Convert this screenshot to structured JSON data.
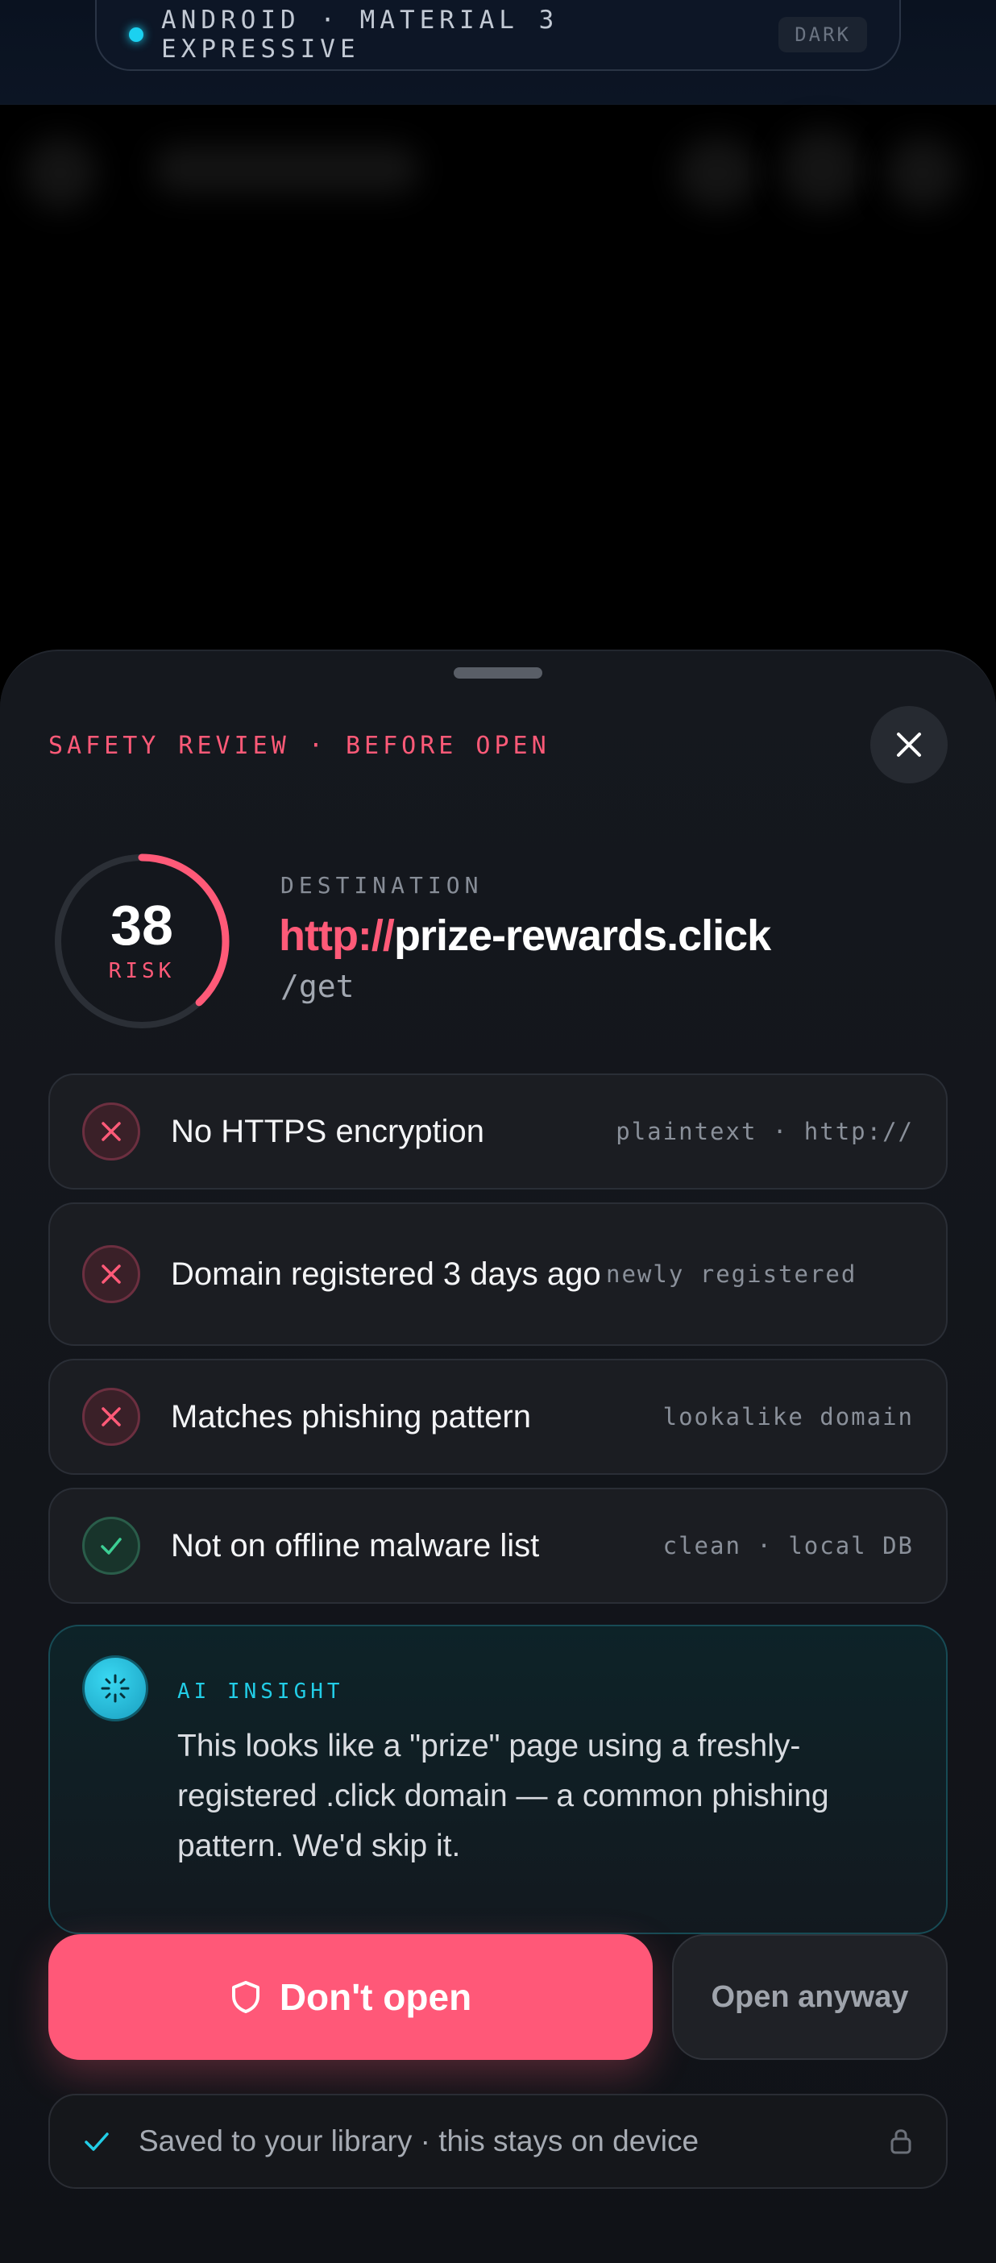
{
  "status_bar": {
    "platform_text": "ANDROID · MATERIAL 3 EXPRESSIVE",
    "theme_badge": "DARK"
  },
  "sheet": {
    "eyebrow": "SAFETY REVIEW · BEFORE OPEN",
    "close_icon": "close-icon"
  },
  "risk": {
    "score": "38",
    "label": "RISK",
    "fraction": 0.38,
    "color": "#ff5a78"
  },
  "destination": {
    "label": "DESTINATION",
    "scheme": "http://",
    "host": "prize-rewards.click",
    "path": "/get"
  },
  "checks": [
    {
      "status": "fail",
      "icon": "x-icon",
      "title": "No HTTPS encryption",
      "tag": "plaintext · http://"
    },
    {
      "status": "fail",
      "icon": "x-icon",
      "title": "Domain registered 3 days ago",
      "tag": "newly registered"
    },
    {
      "status": "fail",
      "icon": "x-icon",
      "title": "Matches phishing pattern",
      "tag": "lookalike domain"
    },
    {
      "status": "pass",
      "icon": "check-icon",
      "title": "Not on offline malware list",
      "tag": "clean · local DB"
    }
  ],
  "insight": {
    "label": "AI INSIGHT",
    "body": "This looks like a \"prize\" page using a freshly-registered .click domain — a common phishing pattern. We'd skip it.",
    "accent": "#22cde6"
  },
  "actions": {
    "primary_label": "Don't open",
    "secondary_label": "Open anyway",
    "primary_color": "#ff5878"
  },
  "footer": {
    "text": "Saved to your library · this stays on device"
  }
}
